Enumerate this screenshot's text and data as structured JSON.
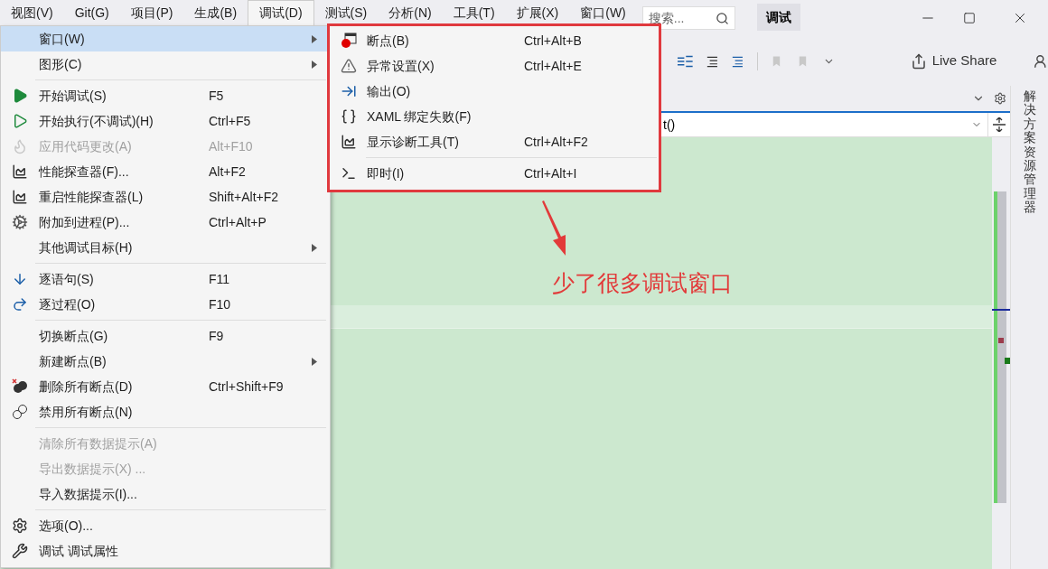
{
  "menubar": {
    "items": [
      {
        "label": "视图(V)",
        "selected": false
      },
      {
        "label": "Git(G)",
        "selected": false
      },
      {
        "label": "项目(P)",
        "selected": false
      },
      {
        "label": "生成(B)",
        "selected": false
      },
      {
        "label": "调试(D)",
        "selected": true
      },
      {
        "label": "测试(S)",
        "selected": false
      },
      {
        "label": "分析(N)",
        "selected": false
      },
      {
        "label": "工具(T)",
        "selected": false
      },
      {
        "label": "扩展(X)",
        "selected": false
      },
      {
        "label": "窗口(W)",
        "selected": false
      }
    ]
  },
  "search": {
    "placeholder": "搜索..."
  },
  "mode_badge": "调试",
  "toolbar": {
    "live_share": "Live Share"
  },
  "editor": {
    "nav_text": "t()"
  },
  "side_panel": {
    "label": "解决方案资源管理器"
  },
  "debug_menu": {
    "groups": [
      [
        {
          "label": "窗口(W)",
          "submenu": true,
          "disabled": false,
          "selected": true
        },
        {
          "label": "图形(C)",
          "submenu": true,
          "disabled": false,
          "selected": false
        }
      ],
      [
        {
          "label": "开始调试(S)",
          "shortcut": "F5",
          "submenu": false,
          "disabled": false,
          "selected": false
        },
        {
          "label": "开始执行(不调试)(H)",
          "shortcut": "Ctrl+F5",
          "submenu": false,
          "disabled": false,
          "selected": false
        },
        {
          "label": "应用代码更改(A)",
          "shortcut": "Alt+F10",
          "submenu": false,
          "disabled": true,
          "selected": false
        },
        {
          "label": "性能探查器(F)...",
          "shortcut": "Alt+F2",
          "submenu": false,
          "disabled": false,
          "selected": false
        },
        {
          "label": "重启性能探查器(L)",
          "shortcut": "Shift+Alt+F2",
          "submenu": false,
          "disabled": false,
          "selected": false
        },
        {
          "label": "附加到进程(P)...",
          "shortcut": "Ctrl+Alt+P",
          "submenu": false,
          "disabled": false,
          "selected": false
        },
        {
          "label": "其他调试目标(H)",
          "submenu": true,
          "disabled": false,
          "selected": false
        }
      ],
      [
        {
          "label": "逐语句(S)",
          "shortcut": "F11",
          "submenu": false,
          "disabled": false,
          "selected": false
        },
        {
          "label": "逐过程(O)",
          "shortcut": "F10",
          "submenu": false,
          "disabled": false,
          "selected": false
        }
      ],
      [
        {
          "label": "切换断点(G)",
          "shortcut": "F9",
          "submenu": false,
          "disabled": false,
          "selected": false
        },
        {
          "label": "新建断点(B)",
          "submenu": true,
          "disabled": false,
          "selected": false
        },
        {
          "label": "删除所有断点(D)",
          "shortcut": "Ctrl+Shift+F9",
          "submenu": false,
          "disabled": false,
          "selected": false
        },
        {
          "label": "禁用所有断点(N)",
          "submenu": false,
          "disabled": false,
          "selected": false
        }
      ],
      [
        {
          "label": "清除所有数据提示(A)",
          "submenu": false,
          "disabled": true,
          "selected": false
        },
        {
          "label": "导出数据提示(X) ...",
          "submenu": false,
          "disabled": true,
          "selected": false
        },
        {
          "label": "导入数据提示(I)...",
          "submenu": false,
          "disabled": false,
          "selected": false
        }
      ],
      [
        {
          "label": "选项(O)...",
          "submenu": false,
          "disabled": false,
          "selected": false
        },
        {
          "label": "调试 调试属性",
          "submenu": false,
          "disabled": false,
          "selected": false
        }
      ]
    ]
  },
  "window_submenu": {
    "groups": [
      [
        {
          "label": "断点(B)",
          "shortcut": "Ctrl+Alt+B"
        },
        {
          "label": "异常设置(X)",
          "shortcut": "Ctrl+Alt+E"
        },
        {
          "label": "输出(O)"
        },
        {
          "label": "XAML 绑定失败(F)"
        },
        {
          "label": "显示诊断工具(T)",
          "shortcut": "Ctrl+Alt+F2"
        }
      ],
      [
        {
          "label": "即时(I)",
          "shortcut": "Ctrl+Alt+I"
        }
      ]
    ]
  },
  "annotation": {
    "text": "少了很多调试窗口"
  }
}
